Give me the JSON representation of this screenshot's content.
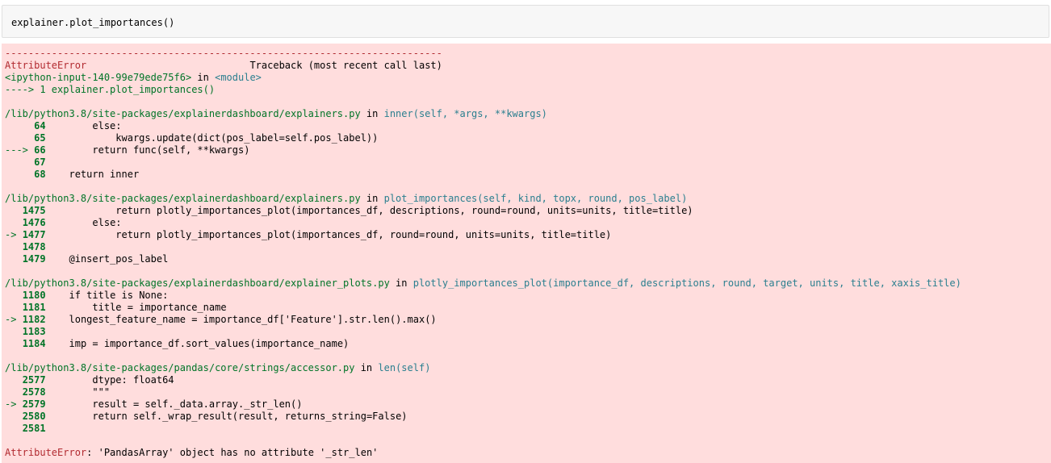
{
  "input": {
    "code": "explainer.plot_importances()"
  },
  "traceback": {
    "separator": "---------------------------------------------------------------------------",
    "header": {
      "error_name": "AttributeError",
      "gap": "                            ",
      "label": "Traceback (most recent call last)"
    },
    "origin": {
      "location": "<ipython-input-140-99e79ede75f6>",
      "in_word": " in ",
      "module": "<module>"
    },
    "origin_line": "----> 1 explainer.plot_importances()",
    "frames": [
      {
        "path": "/lib/python3.8/site-packages/explainerdashboard/explainers.py",
        "in_word": " in ",
        "func": "inner(self, *args, **kwargs)",
        "lines": [
          {
            "marker": "     ",
            "num": "64",
            "code": "        else:"
          },
          {
            "marker": "     ",
            "num": "65",
            "code": "            kwargs.update(dict(pos_label=self.pos_label))"
          },
          {
            "marker": "---> ",
            "num": "66",
            "code": "        return func(self, **kwargs)"
          },
          {
            "marker": "     ",
            "num": "67",
            "code": ""
          },
          {
            "marker": "     ",
            "num": "68",
            "code": "    return inner"
          }
        ]
      },
      {
        "path": "/lib/python3.8/site-packages/explainerdashboard/explainers.py",
        "in_word": " in ",
        "func": "plot_importances(self, kind, topx, round, pos_label)",
        "lines": [
          {
            "marker": "   ",
            "num": "1475",
            "code": "            return plotly_importances_plot(importances_df, descriptions, round=round, units=units, title=title)"
          },
          {
            "marker": "   ",
            "num": "1476",
            "code": "        else:"
          },
          {
            "marker": "-> ",
            "num": "1477",
            "code": "            return plotly_importances_plot(importances_df, round=round, units=units, title=title)"
          },
          {
            "marker": "   ",
            "num": "1478",
            "code": ""
          },
          {
            "marker": "   ",
            "num": "1479",
            "code": "    @insert_pos_label"
          }
        ]
      },
      {
        "path": "/lib/python3.8/site-packages/explainerdashboard/explainer_plots.py",
        "in_word": " in ",
        "func": "plotly_importances_plot(importance_df, descriptions, round, target, units, title, xaxis_title)",
        "lines": [
          {
            "marker": "   ",
            "num": "1180",
            "code": "    if title is None:"
          },
          {
            "marker": "   ",
            "num": "1181",
            "code": "        title = importance_name"
          },
          {
            "marker": "-> ",
            "num": "1182",
            "code": "    longest_feature_name = importance_df['Feature'].str.len().max()"
          },
          {
            "marker": "   ",
            "num": "1183",
            "code": ""
          },
          {
            "marker": "   ",
            "num": "1184",
            "code": "    imp = importance_df.sort_values(importance_name)"
          }
        ]
      },
      {
        "path": "/lib/python3.8/site-packages/pandas/core/strings/accessor.py",
        "in_word": " in ",
        "func": "len(self)",
        "lines": [
          {
            "marker": "   ",
            "num": "2577",
            "code": "        dtype: float64"
          },
          {
            "marker": "   ",
            "num": "2578",
            "code": "        \"\"\""
          },
          {
            "marker": "-> ",
            "num": "2579",
            "code": "        result = self._data.array._str_len()"
          },
          {
            "marker": "   ",
            "num": "2580",
            "code": "        return self._wrap_result(result, returns_string=False)"
          },
          {
            "marker": "   ",
            "num": "2581",
            "code": ""
          }
        ]
      }
    ],
    "final_error": {
      "error_name": "AttributeError",
      "message": ": 'PandasArray' object has no attribute '_str_len'"
    }
  },
  "colors": {
    "error_bg": "#ffdddd",
    "error_name": "#b22b31",
    "path_green": "#007427",
    "func_teal": "#2a7f8f",
    "input_bg": "#f7f7f7"
  }
}
